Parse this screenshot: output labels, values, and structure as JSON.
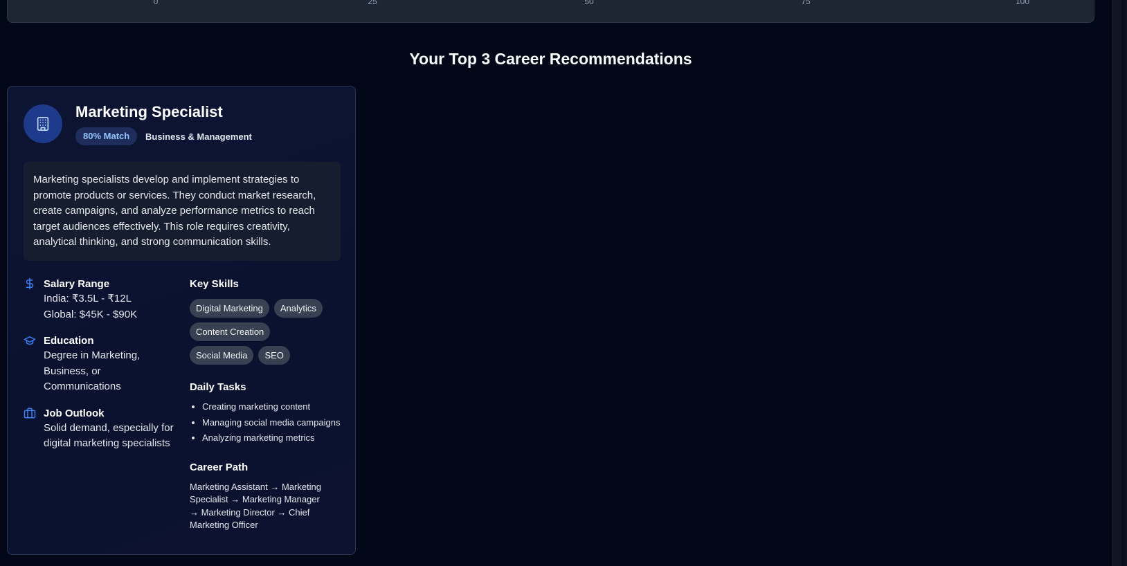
{
  "axis_ticks": [
    "0",
    "25",
    "50",
    "75",
    "100"
  ],
  "section": {
    "title": "Your Top 3 Career Recommendations"
  },
  "career": {
    "icon": "building-icon",
    "title": "Marketing Specialist",
    "match": "80% Match",
    "category": "Business & Management",
    "description": "Marketing specialists develop and implement strategies to promote products or services. They conduct market research, create campaigns, and analyze performance metrics to reach target audiences effectively. This role requires creativity, analytical thinking, and strong communication skills.",
    "salary": {
      "title": "Salary Range",
      "icon": "dollar-icon",
      "india": "India: ₹3.5L - ₹12L",
      "global": "Global: $45K - $90K"
    },
    "education": {
      "title": "Education",
      "icon": "graduation-cap-icon",
      "text": "Degree in Marketing, Business, or Communications"
    },
    "outlook": {
      "title": "Job Outlook",
      "icon": "briefcase-icon",
      "text": "Solid demand, especially for digital marketing specialists"
    },
    "skills_title": "Key Skills",
    "skills": [
      "Digital Marketing",
      "Analytics",
      "Content Creation",
      "Social Media",
      "SEO"
    ],
    "tasks_title": "Daily Tasks",
    "tasks": [
      "Creating marketing content",
      "Managing social media campaigns",
      "Analyzing marketing metrics"
    ],
    "path_title": "Career Path",
    "path": "Marketing Assistant → Marketing Specialist → Marketing Manager → Marketing Director → Chief Marketing Officer"
  },
  "colors": {
    "background": "#020817",
    "card": "#0c1533",
    "accent": "#3b82f6",
    "badge_bg": "#1e2d5c",
    "badge_text": "#93c5fd",
    "skill_bg": "#374151"
  }
}
